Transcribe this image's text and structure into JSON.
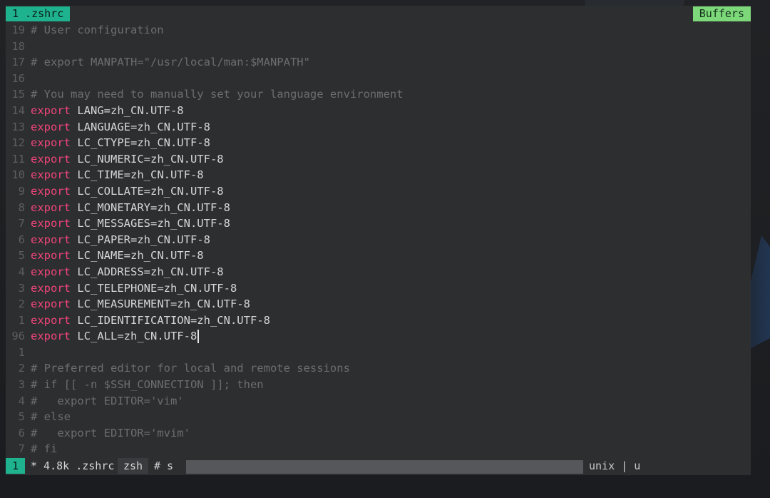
{
  "tabline": {
    "active_tab": "1 .zshrc",
    "buffers_label": "Buffers"
  },
  "lines": [
    {
      "num": "19",
      "parts": [
        {
          "t": "# User configuration",
          "c": "comment"
        }
      ]
    },
    {
      "num": "18",
      "parts": []
    },
    {
      "num": "17",
      "parts": [
        {
          "t": "# export MANPATH=\"/usr/local/man:$MANPATH\"",
          "c": "comment"
        }
      ]
    },
    {
      "num": "16",
      "parts": []
    },
    {
      "num": "15",
      "parts": [
        {
          "t": "# You may need to manually set your language environment",
          "c": "comment"
        }
      ]
    },
    {
      "num": "14",
      "parts": [
        {
          "t": "export",
          "c": "kw"
        },
        {
          "t": " LANG=zh_CN.UTF-8",
          "c": "plain"
        }
      ]
    },
    {
      "num": "13",
      "parts": [
        {
          "t": "export",
          "c": "kw"
        },
        {
          "t": " LANGUAGE=zh_CN.UTF-8",
          "c": "plain"
        }
      ]
    },
    {
      "num": "12",
      "parts": [
        {
          "t": "export",
          "c": "kw"
        },
        {
          "t": " LC_CTYPE=zh_CN.UTF-8",
          "c": "plain"
        }
      ]
    },
    {
      "num": "11",
      "parts": [
        {
          "t": "export",
          "c": "kw"
        },
        {
          "t": " LC_NUMERIC=zh_CN.UTF-8",
          "c": "plain"
        }
      ]
    },
    {
      "num": "10",
      "parts": [
        {
          "t": "export",
          "c": "kw"
        },
        {
          "t": " LC_TIME=zh_CN.UTF-8",
          "c": "plain"
        }
      ]
    },
    {
      "num": "9",
      "parts": [
        {
          "t": "export",
          "c": "kw"
        },
        {
          "t": " LC_COLLATE=zh_CN.UTF-8",
          "c": "plain"
        }
      ]
    },
    {
      "num": "8",
      "parts": [
        {
          "t": "export",
          "c": "kw"
        },
        {
          "t": " LC_MONETARY=zh_CN.UTF-8",
          "c": "plain"
        }
      ]
    },
    {
      "num": "7",
      "parts": [
        {
          "t": "export",
          "c": "kw"
        },
        {
          "t": " LC_MESSAGES=zh_CN.UTF-8",
          "c": "plain"
        }
      ]
    },
    {
      "num": "6",
      "parts": [
        {
          "t": "export",
          "c": "kw"
        },
        {
          "t": " LC_PAPER=zh_CN.UTF-8",
          "c": "plain"
        }
      ]
    },
    {
      "num": "5",
      "parts": [
        {
          "t": "export",
          "c": "kw"
        },
        {
          "t": " LC_NAME=zh_CN.UTF-8",
          "c": "plain"
        }
      ]
    },
    {
      "num": "4",
      "parts": [
        {
          "t": "export",
          "c": "kw"
        },
        {
          "t": " LC_ADDRESS=zh_CN.UTF-8",
          "c": "plain"
        }
      ]
    },
    {
      "num": "3",
      "parts": [
        {
          "t": "export",
          "c": "kw"
        },
        {
          "t": " LC_TELEPHONE=zh_CN.UTF-8",
          "c": "plain"
        }
      ]
    },
    {
      "num": "2",
      "parts": [
        {
          "t": "export",
          "c": "kw"
        },
        {
          "t": " LC_MEASUREMENT=zh_CN.UTF-8",
          "c": "plain"
        }
      ]
    },
    {
      "num": "1",
      "parts": [
        {
          "t": "export",
          "c": "kw"
        },
        {
          "t": " LC_IDENTIFICATION=zh_CN.UTF-8",
          "c": "plain"
        }
      ]
    },
    {
      "num": "96",
      "cursor": true,
      "parts": [
        {
          "t": "export",
          "c": "kw"
        },
        {
          "t": " LC_ALL=zh_CN.UTF-8",
          "c": "plain"
        }
      ]
    },
    {
      "num": "1",
      "parts": []
    },
    {
      "num": "2",
      "parts": [
        {
          "t": "# Preferred editor for local and remote sessions",
          "c": "comment"
        }
      ]
    },
    {
      "num": "3",
      "parts": [
        {
          "t": "# if [[ -n $SSH_CONNECTION ]]; then",
          "c": "comment"
        }
      ]
    },
    {
      "num": "4",
      "parts": [
        {
          "t": "#   export EDITOR='vim'",
          "c": "comment"
        }
      ]
    },
    {
      "num": "5",
      "parts": [
        {
          "t": "# else",
          "c": "comment"
        }
      ]
    },
    {
      "num": "6",
      "parts": [
        {
          "t": "#   export EDITOR='mvim'",
          "c": "comment"
        }
      ]
    },
    {
      "num": "7",
      "parts": [
        {
          "t": "# fi",
          "c": "comment"
        }
      ]
    }
  ],
  "statusline": {
    "mode": "1",
    "file": "* 4.8k .zshrc",
    "filetype": "zsh",
    "section": "# s",
    "right": "unix | u"
  },
  "colors": {
    "keyword": "#f0457a",
    "comment": "#6b6d71",
    "accent_green": "#1fb28e",
    "buffers_green": "#7dd87a",
    "background": "#2d2e30"
  }
}
